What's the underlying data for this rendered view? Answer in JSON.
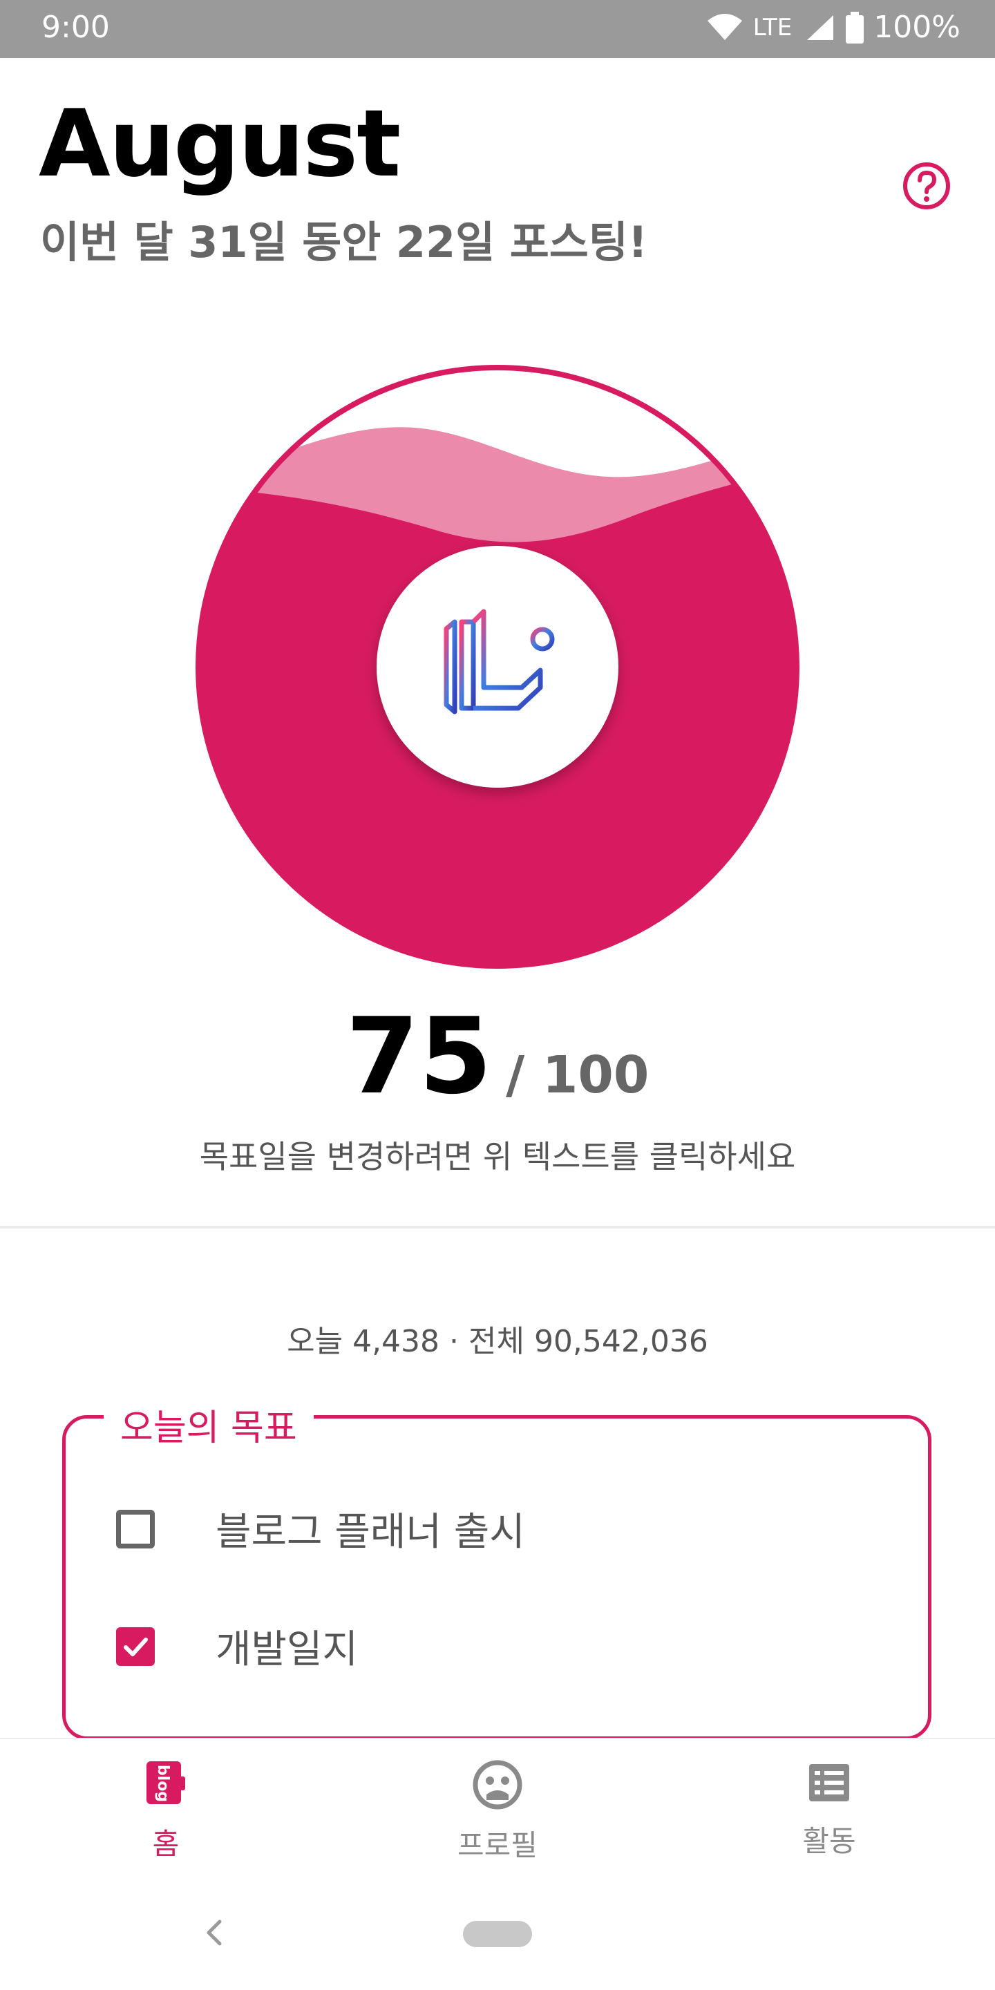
{
  "status_bar": {
    "time": "9:00",
    "network": "LTE",
    "battery": "100%",
    "icons": [
      "wifi-icon",
      "signal-icon",
      "battery-icon"
    ]
  },
  "header": {
    "title": "August",
    "subtitle": "이번 달 31일 동안 22일 포스팅!",
    "help_icon": "help-circle-icon"
  },
  "progress": {
    "score": "75",
    "goal": "/ 100",
    "fill_fraction": 0.75,
    "hint": "목표일을 변경하려면 위 텍스트를 클릭하세요"
  },
  "stats": {
    "text": "오늘 4,438 · 전체 90,542,036"
  },
  "goals": {
    "title": "오늘의 목표",
    "items": [
      {
        "label": "블로그 플래너 출시",
        "checked": false
      },
      {
        "label": "개발일지",
        "checked": true
      }
    ]
  },
  "bottom_nav": {
    "items": [
      {
        "label": "홈",
        "icon": "blog-home-icon",
        "active": true
      },
      {
        "label": "프로필",
        "icon": "profile-icon",
        "active": false
      },
      {
        "label": "활동",
        "icon": "list-icon",
        "active": false
      }
    ]
  },
  "colors": {
    "accent": "#d81b60",
    "accent_light": "#ec8aac",
    "status_bar": "#9a9a9a",
    "text_muted": "#666666"
  }
}
